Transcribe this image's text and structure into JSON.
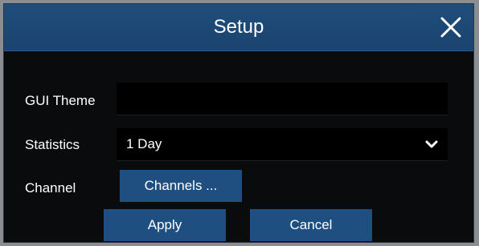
{
  "dialog": {
    "title": "Setup",
    "close_icon": "close-icon"
  },
  "form": {
    "gui_theme": {
      "label": "GUI Theme",
      "value": ""
    },
    "statistics": {
      "label": "Statistics",
      "value": "1 Day",
      "dropdown_icon": "chevron-down-icon"
    },
    "channel": {
      "label": "Channel",
      "button_label": "Channels ..."
    }
  },
  "actions": {
    "apply_label": "Apply",
    "cancel_label": "Cancel"
  },
  "colors": {
    "titlebar": "#1f4d7a",
    "button": "#1e4f80",
    "background": "#0a0b0d"
  }
}
